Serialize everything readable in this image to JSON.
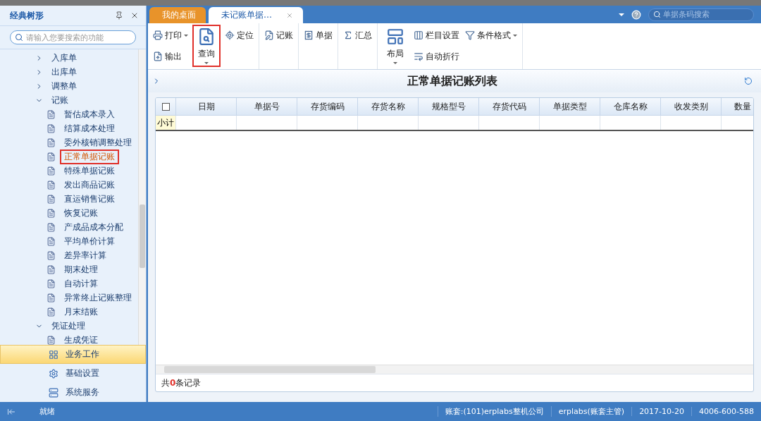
{
  "sidebar": {
    "title": "经典树形",
    "search": {
      "placeholder": "请输入您要搜索的功能"
    },
    "tree": [
      {
        "label": "入库单",
        "expanded": false
      },
      {
        "label": "出库单",
        "expanded": false
      },
      {
        "label": "调整单",
        "expanded": false
      },
      {
        "label": "记账",
        "expanded": true,
        "children": [
          {
            "label": "暂估成本录入",
            "selected": false,
            "highlighted": false
          },
          {
            "label": "结算成本处理",
            "selected": false,
            "highlighted": false
          },
          {
            "label": "委外核销调整处理",
            "selected": false,
            "highlighted": false
          },
          {
            "label": "正常单据记账",
            "selected": true,
            "highlighted": true
          },
          {
            "label": "特殊单据记账",
            "selected": false,
            "highlighted": false
          },
          {
            "label": "发出商品记账",
            "selected": false,
            "highlighted": false
          },
          {
            "label": "直运销售记账",
            "selected": false,
            "highlighted": false
          },
          {
            "label": "恢复记账",
            "selected": false,
            "highlighted": false
          },
          {
            "label": "产成品成本分配",
            "selected": false,
            "highlighted": false
          },
          {
            "label": "平均单价计算",
            "selected": false,
            "highlighted": false
          },
          {
            "label": "差异率计算",
            "selected": false,
            "highlighted": false
          },
          {
            "label": "期末处理",
            "selected": false,
            "highlighted": false
          },
          {
            "label": "自动计算",
            "selected": false,
            "highlighted": false
          },
          {
            "label": "异常终止记账整理",
            "selected": false,
            "highlighted": false
          },
          {
            "label": "月末结账",
            "selected": false,
            "highlighted": false
          }
        ]
      },
      {
        "label": "凭证处理",
        "expanded": true,
        "children": [
          {
            "label": "生成凭证",
            "selected": false,
            "highlighted": false
          }
        ]
      }
    ],
    "nav": [
      {
        "label": "业务工作",
        "kind": "work",
        "selected": true
      },
      {
        "label": "基础设置",
        "kind": "settings",
        "selected": false
      },
      {
        "label": "系统服务",
        "kind": "service",
        "selected": false
      }
    ]
  },
  "tabs": [
    {
      "label": "我的桌面",
      "selected": false,
      "closable": false
    },
    {
      "label": "未记账单据…",
      "selected": true,
      "closable": true
    }
  ],
  "top_search": {
    "placeholder": "单据条码搜索"
  },
  "toolbar": [
    {
      "items": [
        {
          "label": "打印",
          "kind": "print",
          "large": false,
          "dropdown": true,
          "highlighted": false
        },
        {
          "label": "输出",
          "kind": "export",
          "large": false,
          "dropdown": false,
          "highlighted": false
        },
        {
          "label": "查询",
          "kind": "query",
          "large": true,
          "dropdown": true,
          "highlighted": true
        },
        {
          "label": "定位",
          "kind": "locate",
          "large": false,
          "dropdown": false,
          "highlighted": false
        }
      ]
    },
    {
      "items": [
        {
          "label": "记账",
          "kind": "post",
          "large": false,
          "dropdown": false,
          "highlighted": false
        }
      ]
    },
    {
      "items": [
        {
          "label": "单据",
          "kind": "voucher",
          "large": false,
          "dropdown": false,
          "highlighted": false
        }
      ]
    },
    {
      "items": [
        {
          "label": "汇总",
          "kind": "sum",
          "large": false,
          "dropdown": false,
          "highlighted": false
        }
      ]
    },
    {
      "items": [
        {
          "label": "布局",
          "kind": "layout",
          "large": true,
          "dropdown": true,
          "highlighted": false
        },
        {
          "label": "栏目设置",
          "kind": "columns",
          "large": false,
          "dropdown": false,
          "highlighted": false
        },
        {
          "label": "自动折行",
          "kind": "wrap",
          "large": false,
          "dropdown": false,
          "highlighted": false
        },
        {
          "label": "条件格式",
          "kind": "format",
          "large": false,
          "dropdown": true,
          "highlighted": false
        }
      ]
    }
  ],
  "page_title": "正常单据记账列表",
  "table": {
    "columns": [
      "日期",
      "单据号",
      "存货编码",
      "存货名称",
      "规格型号",
      "存货代码",
      "单据类型",
      "仓库名称",
      "收发类别",
      "数量"
    ],
    "select_all_checked": false,
    "subtotal_label": "小计"
  },
  "record_count": "共**0**条记录",
  "status_bar": {
    "message": "就绪",
    "items": [
      "账套:(101)erplabs整机公司",
      "erplabs(账套主管)",
      "2017-10-20",
      "4006-600-588"
    ]
  }
}
